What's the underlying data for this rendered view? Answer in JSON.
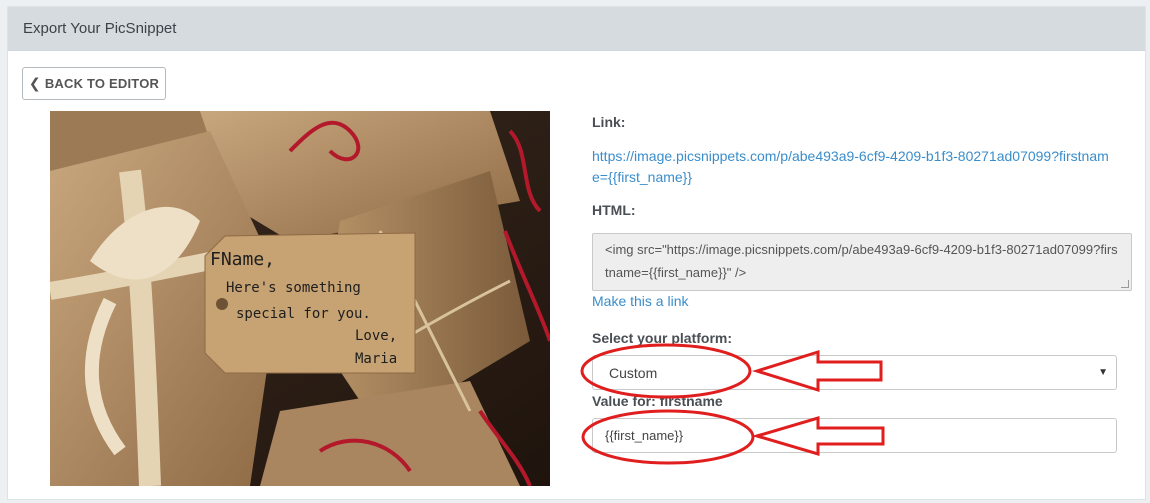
{
  "header": {
    "title": "Export Your PicSnippet"
  },
  "back_button": {
    "label": "BACK TO EDITOR"
  },
  "image": {
    "tag_lines": [
      "FName,",
      "Here's something",
      "special for you.",
      "Love,",
      "Maria"
    ]
  },
  "link_section": {
    "label": "Link:",
    "url": "https://image.picsnippets.com/p/abe493a9-6cf9-4209-b1f3-80271ad07099?firstname={{first_name}}"
  },
  "html_section": {
    "label": "HTML:",
    "code": "<img src=\"https://image.picsnippets.com/p/abe493a9-6cf9-4209-b1f3-80271ad07099?firstname={{first_name}}\" />",
    "make_link_label": "Make this a link"
  },
  "platform": {
    "label": "Select your platform:",
    "selected": "Custom"
  },
  "firstname_field": {
    "label": "Value for: firstname",
    "value": "{{first_name}}"
  },
  "colors": {
    "link": "#3a8dcb",
    "header_bg": "#d5dbdf",
    "annotation_red": "#e01e1e"
  },
  "icons": {
    "back": "chevron-left-icon",
    "dropdown": "caret-down-icon"
  }
}
